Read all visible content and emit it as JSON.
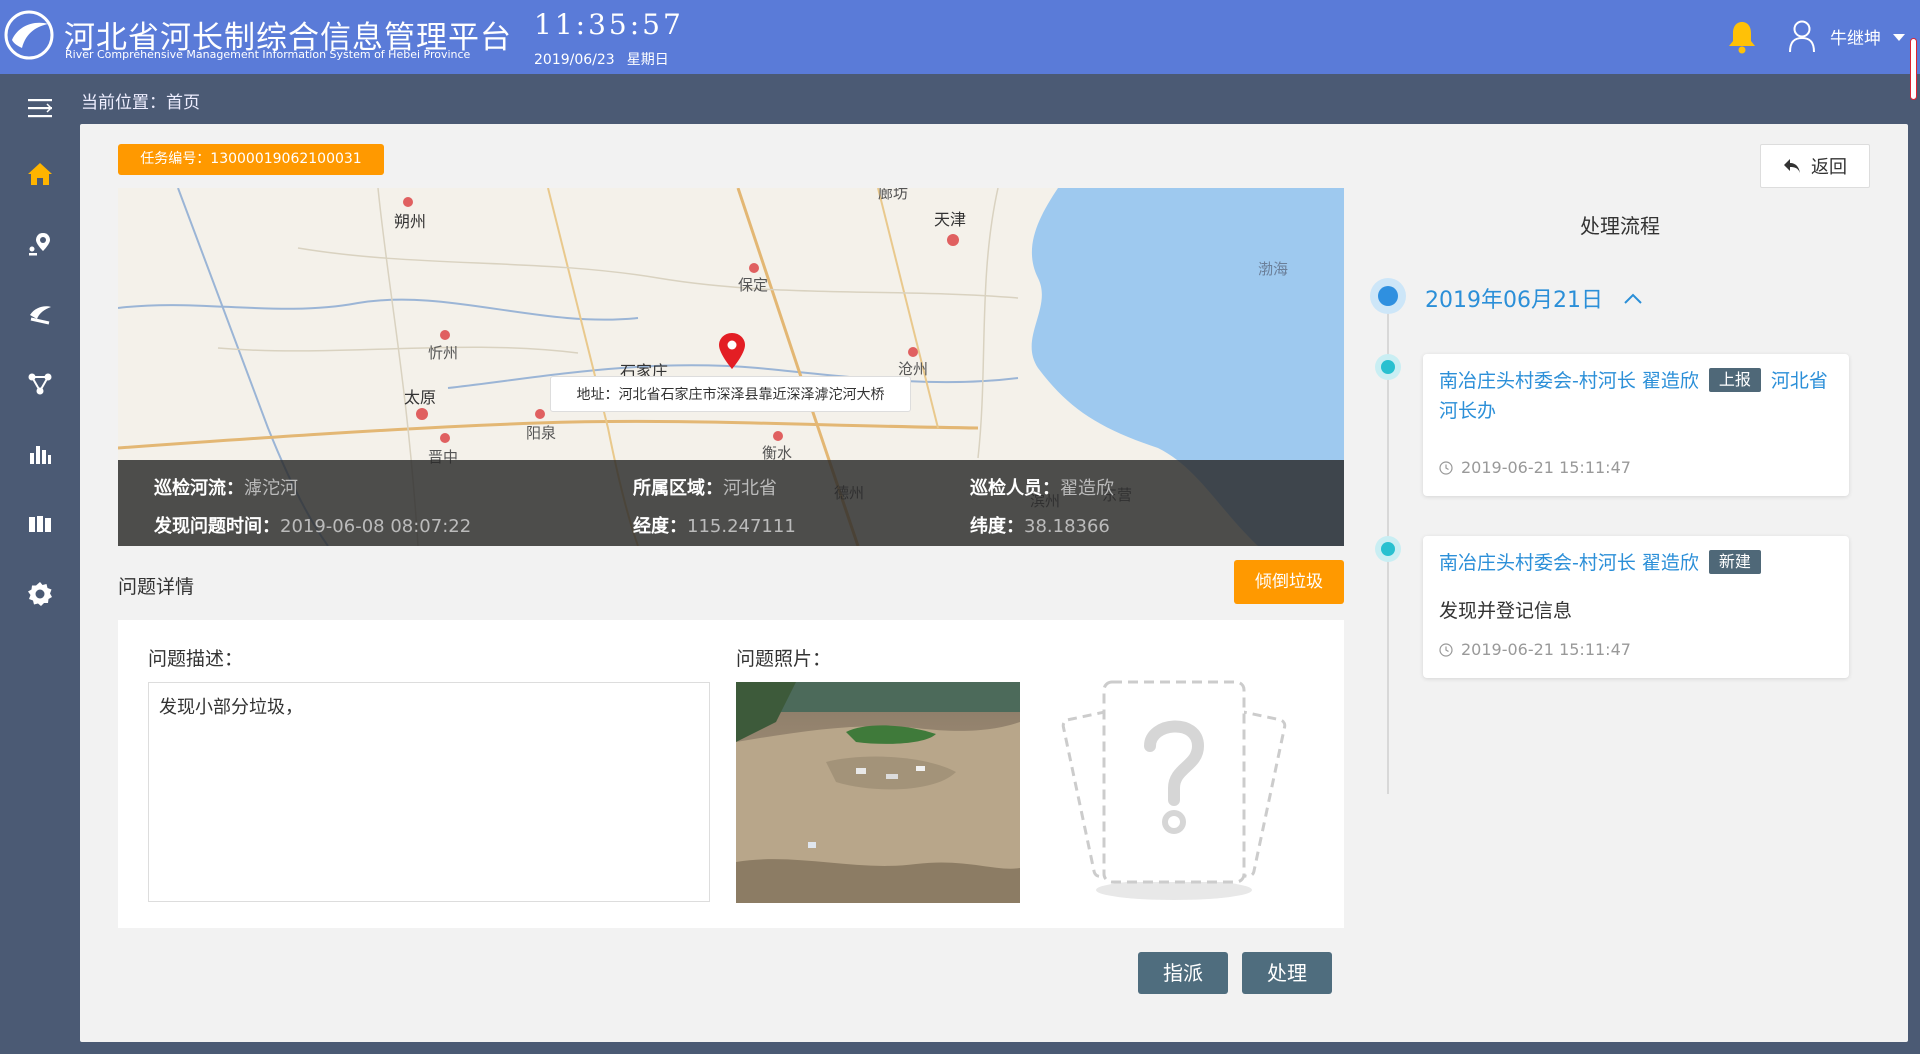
{
  "header": {
    "title_cn": "河北省河长制综合信息管理平台",
    "title_en": "River Comprehensive Management Information  System of Hebei Province",
    "time": "11:35:57",
    "date": "2019/06/23",
    "weekday": "星期日",
    "user": "牛继坤",
    "icons": [
      "logo-icon",
      "bell-icon",
      "user-icon",
      "caret-down-icon"
    ]
  },
  "breadcrumb": "当前位置：首页",
  "sidebar": {
    "items": [
      "menu-toggle-icon",
      "home-icon",
      "map-pin-icon",
      "patrol-icon",
      "network-icon",
      "bar-chart-icon",
      "books-icon",
      "gear-icon"
    ],
    "active_color": "#ffb400"
  },
  "task": {
    "badge": "任务编号：13000019062100031",
    "back_label": "返回"
  },
  "map": {
    "cities": [
      "朔州",
      "天津",
      "保定",
      "忻州",
      "石家庄",
      "沧州",
      "太原",
      "阳泉",
      "晋中",
      "衡水",
      "德州",
      "滨州",
      "东营",
      "廊坊"
    ],
    "sea": "渤海",
    "address_tooltip": "地址：河北省石家庄市深泽县靠近深泽滹沱河大桥"
  },
  "info": {
    "river_label": "巡检河流：",
    "river": "滹沱河",
    "region_label": "所属区域：",
    "region": "河北省",
    "inspector_label": "巡检人员：",
    "inspector": "翟造欣",
    "found_time_label": "发现问题时间：",
    "found_time": "2019-06-08 08:07:22",
    "longitude_label": "经度：",
    "longitude": "115.247111",
    "latitude_label": "纬度：",
    "latitude": "38.18366"
  },
  "detail": {
    "title": "问题详情",
    "category": "倾倒垃圾",
    "desc_label": "问题描述：",
    "desc": "发现小部分垃圾，",
    "photo_label": "问题照片："
  },
  "flow": {
    "title": "处理流程",
    "date": "2019年06月21日",
    "items": [
      {
        "actor": "南冶庄头村委会-村河长 翟造欣",
        "tag": "上报",
        "target": "河北省河长办",
        "desc": "",
        "time": "2019-06-21 15:11:47"
      },
      {
        "actor": "南冶庄头村委会-村河长 翟造欣",
        "tag": "新建",
        "target": "",
        "desc": "发现并登记信息",
        "time": "2019-06-21 15:11:47"
      }
    ]
  },
  "actions": {
    "assign": "指派",
    "handle": "处理"
  },
  "colors": {
    "header": "#5a7bd8",
    "sidebar": "#4b5a74",
    "accent_orange": "#ff9900",
    "timeline_blue": "#2b8fd8",
    "action_button": "#4f6d7e"
  }
}
